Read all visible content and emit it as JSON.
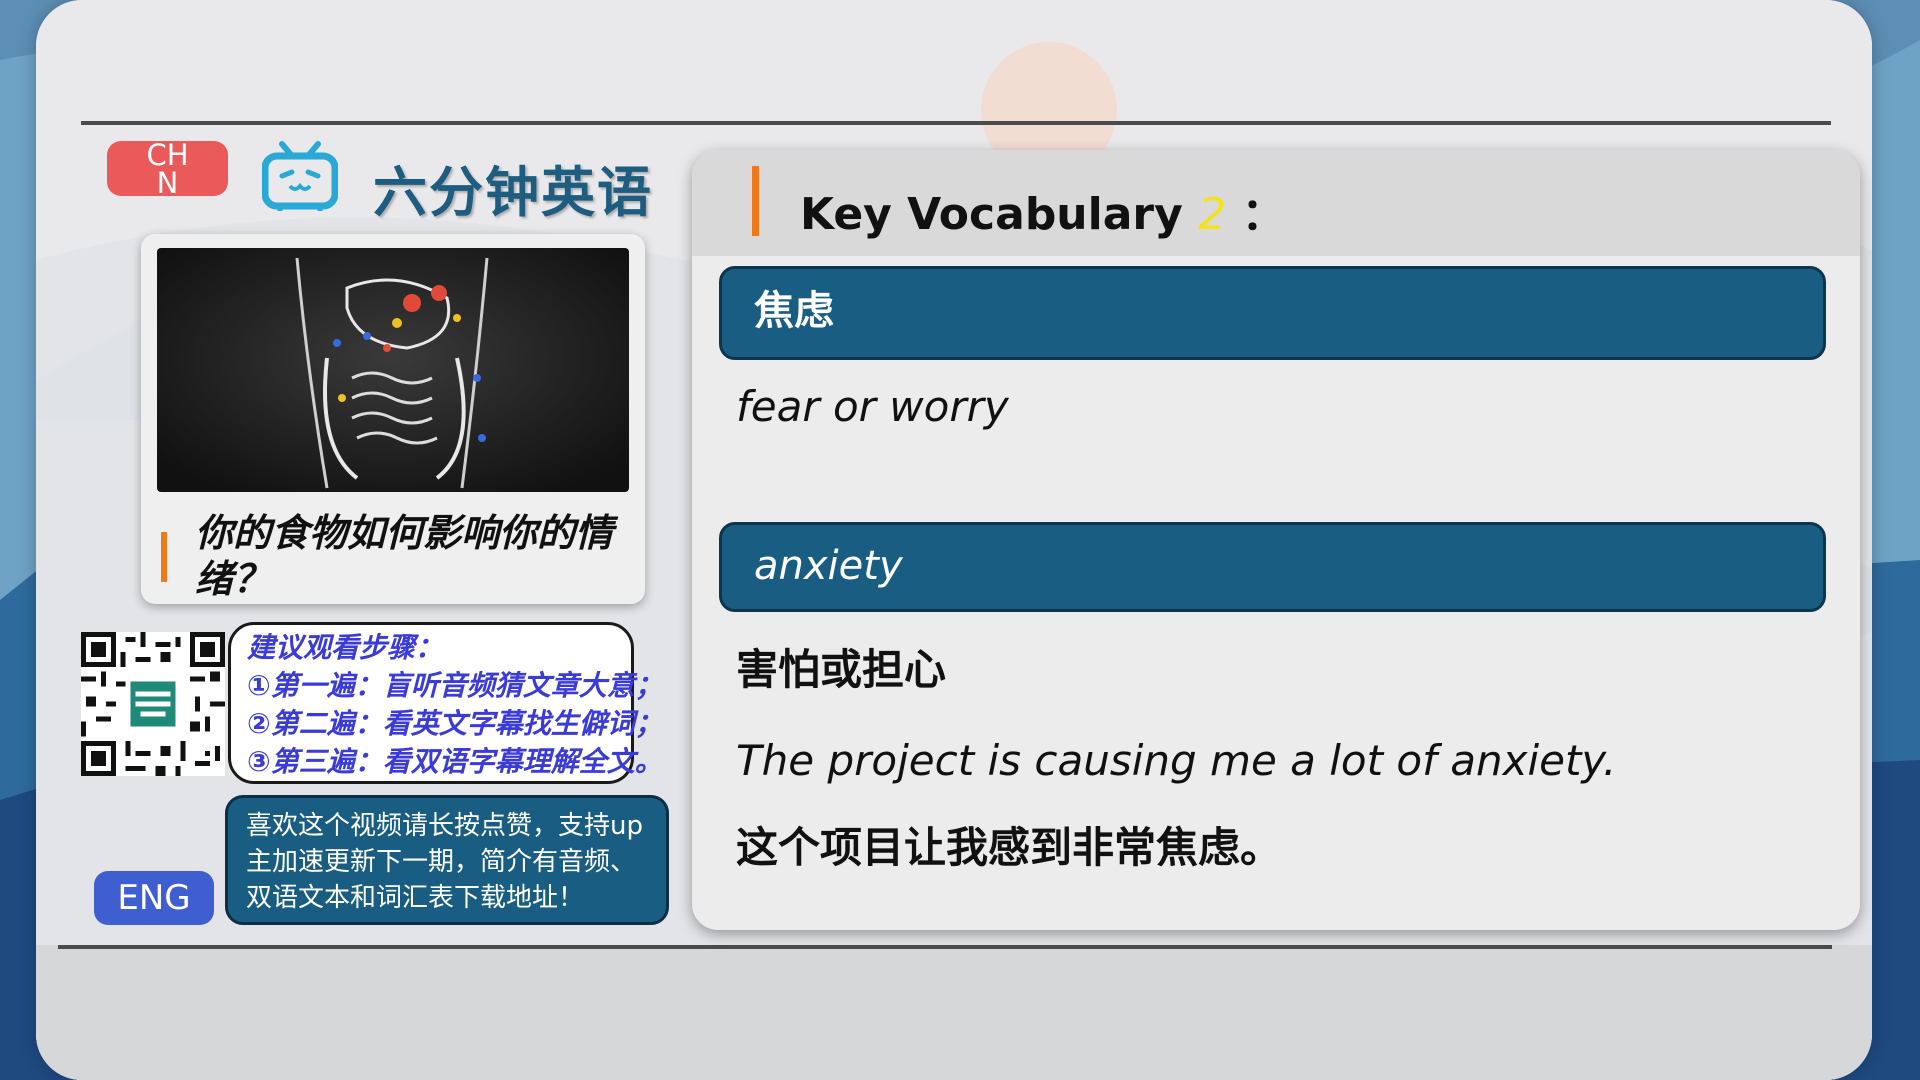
{
  "colors": {
    "accent_red": "#ea5a5b",
    "accent_blue": "#3f5fd0",
    "teal": "#195e82",
    "orange_marker": "#f07a1a",
    "highlight_number": "#f4e21d"
  },
  "header": {
    "chn_label": "CHN",
    "brand_title": "六分钟英语",
    "tv_icon": "bilibili-tv-icon"
  },
  "episode": {
    "title": "你的食物如何影响你的情绪？"
  },
  "steps": {
    "heading": "建议观看步骤：",
    "step1": "①第一遍：盲听音频猜文章大意；",
    "step2": "②第二遍：看英文字幕找生僻词；",
    "step3": "③第三遍：看双语字幕理解全文。"
  },
  "promo": {
    "text": "喜欢这个视频请长按点赞，支持up主加速更新下一期，简介有音频、双语文本和词汇表下载地址！"
  },
  "footer": {
    "eng_label": "ENG"
  },
  "vocab": {
    "heading": "Key Vocabulary",
    "number": "2",
    "colon": "：",
    "term1": "焦虑",
    "term1_def": "fear or worry",
    "term2": "anxiety",
    "term2_def": "害怕或担心",
    "example_en": "The project is causing me a lot of anxiety.",
    "example_zh": "这个项目让我感到非常焦虑。"
  }
}
